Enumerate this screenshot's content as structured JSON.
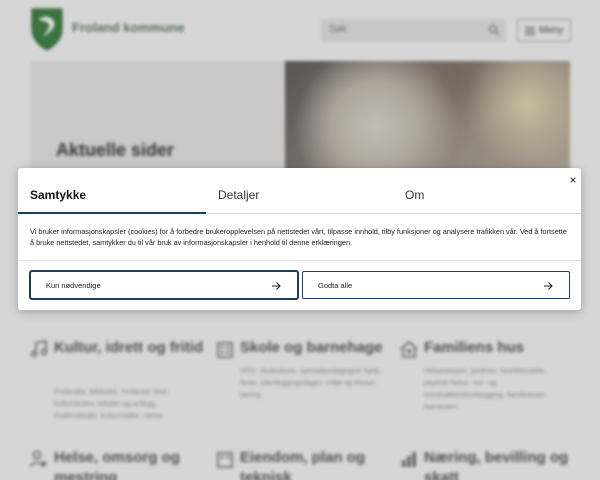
{
  "site": {
    "name": "Froland kommune",
    "search_placeholder": "Søk",
    "menu_label": "Meny"
  },
  "hero": {
    "title": "Aktuelle sider"
  },
  "sections": [
    {
      "title": "Kultur, idrett og fritid",
      "desc": "Frolandia, bibliotek, Frolands Verk, kulturskolen, lokaler og anlegg, frisklivsklubb, kulturmidler, vielse."
    },
    {
      "title": "Skole og barnehage",
      "desc": "SFO, skoleskyss, spesialpedagogisk hjelp, ferier, planleggingsdager, miljø og trivsel, læring."
    },
    {
      "title": "Familiens hus",
      "desc": "Helsestasjon, jordmor, foreldrestøtte, psykisk helse, rus- og kriminalitetsforebygging, familieteam, barnevern."
    },
    {
      "title": "Helse, omsorg og mestring",
      "desc": ""
    },
    {
      "title": "Eiendom, plan og teknisk",
      "desc": ""
    },
    {
      "title": "Næring, bevilling og skatt",
      "desc": ""
    }
  ],
  "consent": {
    "tabs": [
      "Samtykke",
      "Detaljer",
      "Om"
    ],
    "close_symbol": "×",
    "text": "Vi bruker informasjonskapsler (cookies) for å forbedre brukeropplevelsen på nettstedet vårt, tilpasse innhold, tilby funksjoner og analysere trafikken vår. Ved å fortsette å bruke nettstedet, samtykker du til vår bruk av informasjonskapsler i henhold til denne erklæringen.",
    "necessary_label": "Kun nødvendige",
    "accept_label": "Godta alle"
  },
  "colors": {
    "accent": "#1e3c63",
    "brand_green": "#3e7a45"
  },
  "icons": [
    "logo-shield-icon",
    "search-icon",
    "hamburger-icon",
    "music-note-icon",
    "building-icon",
    "house-heart-icon",
    "person-heart-icon",
    "building-icon",
    "chart-icon",
    "close-icon",
    "arrow-right-icon"
  ]
}
